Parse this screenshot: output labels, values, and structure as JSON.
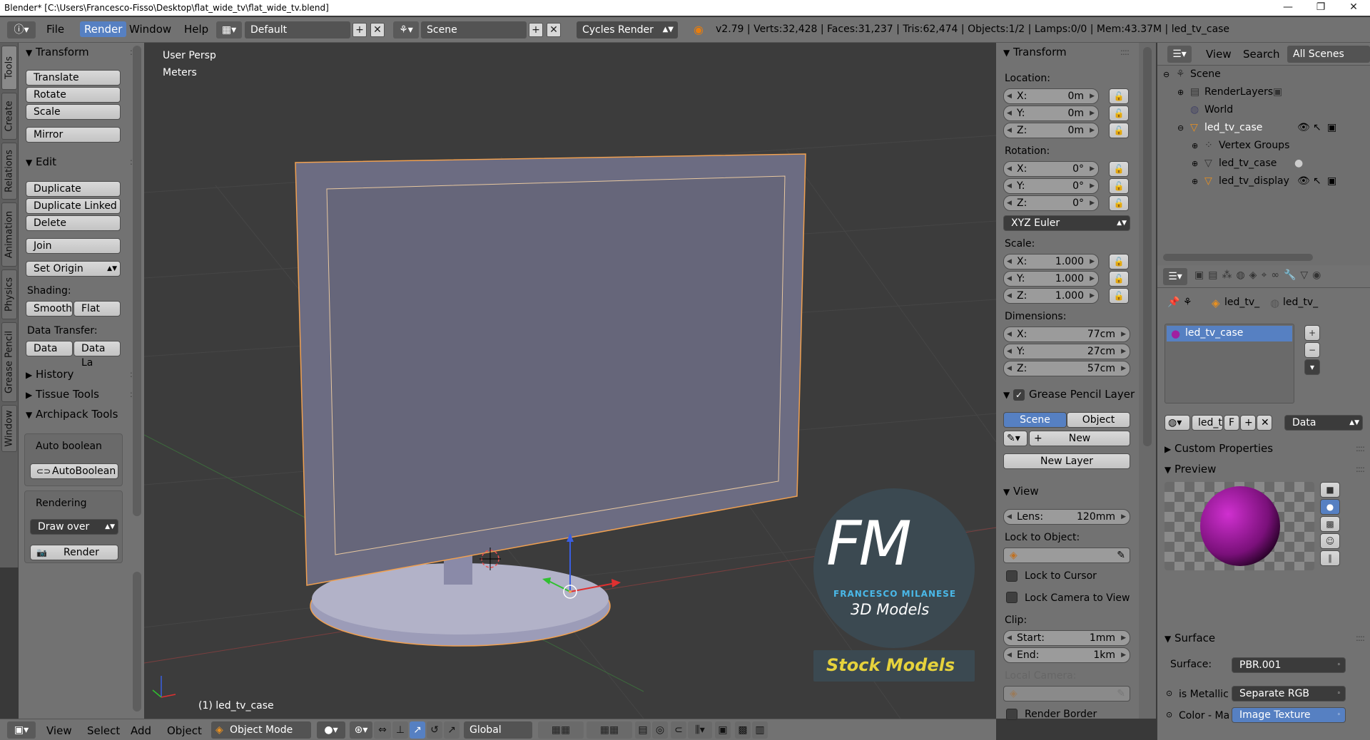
{
  "window": {
    "title": "Blender* [C:\\Users\\Francesco-Fisso\\Desktop\\flat_wide_tv\\flat_wide_tv.blend]",
    "minimize": "—",
    "maximize": "❐",
    "close": "✕"
  },
  "topbar": {
    "menus": [
      "File",
      "Render",
      "Window",
      "Help"
    ],
    "layout": "Default",
    "scene": "Scene",
    "engine": "Cycles Render",
    "stats": "v2.79 | Verts:32,428 | Faces:31,237 | Tris:62,474 | Objects:1/2 | Lamps:0/0 | Mem:43.37M | led_tv_case"
  },
  "vtabs": [
    "Tools",
    "Create",
    "Relations",
    "Animation",
    "Physics",
    "Grease Pencil",
    "Window"
  ],
  "toolshelf": {
    "transform_title": "Transform",
    "translate": "Translate",
    "rotate": "Rotate",
    "scale": "Scale",
    "mirror": "Mirror",
    "edit_title": "Edit",
    "duplicate": "Duplicate",
    "duplicate_linked": "Duplicate Linked",
    "delete": "Delete",
    "join": "Join",
    "set_origin": "Set Origin",
    "shading_label": "Shading:",
    "smooth": "Smooth",
    "flat": "Flat",
    "data_transfer_label": "Data Transfer:",
    "data": "Data",
    "data_la": "Data La",
    "history": "History",
    "tissue_tools": "Tissue Tools",
    "archipack_tools": "Archipack Tools",
    "auto_boolean_label": "Auto boolean",
    "auto_boolean_btn": "AutoBoolean",
    "rendering_label": "Rendering",
    "draw_over": "Draw over",
    "render": "Render"
  },
  "viewport": {
    "view_name": "User Persp",
    "units": "Meters",
    "object_label": "(1) led_tv_case",
    "logo_letters": "FM",
    "logo_name": "FRANCESCO MILANESE",
    "logo_sub": "3D Models",
    "stock": "Stock Models"
  },
  "npanel": {
    "transform_title": "Transform",
    "location_label": "Location:",
    "loc_x": "0m",
    "loc_y": "0m",
    "loc_z": "0m",
    "rotation_label": "Rotation:",
    "rot_x": "0°",
    "rot_y": "0°",
    "rot_z": "0°",
    "rotation_mode": "XYZ Euler",
    "scale_label": "Scale:",
    "scale_x": "1.000",
    "scale_y": "1.000",
    "scale_z": "1.000",
    "dimensions_label": "Dimensions:",
    "dim_x": "77cm",
    "dim_y": "27cm",
    "dim_z": "57cm",
    "x": "X:",
    "y": "Y:",
    "z": "Z:",
    "grease_title": "Grease Pencil Layer",
    "scene_tab": "Scene",
    "object_tab": "Object",
    "new": "New",
    "new_layer": "New Layer",
    "view_title": "View",
    "lens_label": "Lens:",
    "lens_value": "120mm",
    "lock_to_object": "Lock to Object:",
    "lock_to_cursor": "Lock to Cursor",
    "lock_camera": "Lock Camera to View",
    "clip_label": "Clip:",
    "clip_start_label": "Start:",
    "clip_start": "1mm",
    "clip_end_label": "End:",
    "clip_end": "1km",
    "local_camera": "Local Camera:",
    "render_border": "Render Border"
  },
  "outliner": {
    "view": "View",
    "search": "Search",
    "filter": "All Scenes",
    "rows": [
      "Scene",
      "RenderLayers",
      "World",
      "led_tv_case",
      "Vertex Groups",
      "led_tv_case",
      "led_tv_display"
    ]
  },
  "properties": {
    "crumb1": "led_tv_",
    "crumb2": "led_tv_",
    "material_slot": "led_tv_case",
    "mat_name": "led_t",
    "mat_f": "F",
    "data_select": "Data",
    "custom_props": "Custom Properties",
    "preview": "Preview",
    "surface_title": "Surface",
    "surface_label": "Surface:",
    "surface_value": "PBR.001",
    "is_metallic": "is Metallic",
    "separate_rgb": "Separate RGB",
    "color_ma": "Color - Ma",
    "image_texture": "Image Texture"
  },
  "bottombar": {
    "view": "View",
    "select": "Select",
    "add": "Add",
    "object": "Object",
    "mode": "Object Mode",
    "orientation": "Global"
  }
}
